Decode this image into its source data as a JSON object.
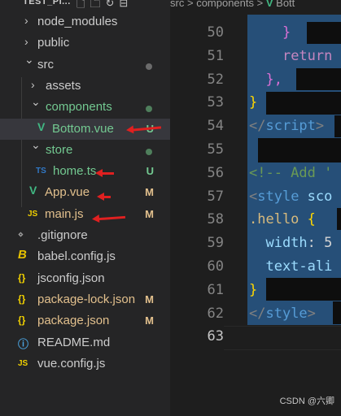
{
  "explorer": {
    "title": "TEST_PI...",
    "header_icons": [
      "new-file-icon",
      "new-folder-icon",
      "refresh-icon",
      "collapse-icon"
    ],
    "items": [
      {
        "label": "node_modules",
        "kind": "folder",
        "expanded": false,
        "color": "#cccccc"
      },
      {
        "label": "public",
        "kind": "folder",
        "expanded": false,
        "color": "#cccccc"
      },
      {
        "label": "src",
        "kind": "folder",
        "expanded": true,
        "color": "#cccccc",
        "status": "dot",
        "status_color": "#6b6b6b"
      },
      {
        "label": "assets",
        "kind": "folder",
        "expanded": false,
        "color": "#cccccc"
      },
      {
        "label": "components",
        "kind": "folder",
        "expanded": true,
        "color": "#73c991",
        "status": "dot",
        "status_color": "#4f7f5c"
      },
      {
        "label": "Bottom.vue",
        "kind": "file",
        "icon": "vue",
        "color": "#73c991",
        "status": "U",
        "selected": true
      },
      {
        "label": "store",
        "kind": "folder",
        "expanded": true,
        "color": "#73c991",
        "status": "dot",
        "status_color": "#4f7f5c"
      },
      {
        "label": "home.ts",
        "kind": "file",
        "icon": "TS",
        "color": "#73c991",
        "status": "U"
      },
      {
        "label": "App.vue",
        "kind": "file",
        "icon": "vue",
        "color": "#e2c08d",
        "status": "M"
      },
      {
        "label": "main.js",
        "kind": "file",
        "icon": "JS",
        "color": "#e2c08d",
        "status": "M"
      },
      {
        "label": ".gitignore",
        "kind": "file",
        "icon": "git",
        "color": "#cccccc"
      },
      {
        "label": "babel.config.js",
        "kind": "file",
        "icon": "babel",
        "color": "#cccccc"
      },
      {
        "label": "jsconfig.json",
        "kind": "file",
        "icon": "{}",
        "color": "#cccccc"
      },
      {
        "label": "package-lock.json",
        "kind": "file",
        "icon": "{}",
        "color": "#e2c08d",
        "status": "M"
      },
      {
        "label": "package.json",
        "kind": "file",
        "icon": "{}",
        "color": "#e2c08d",
        "status": "M"
      },
      {
        "label": "README.md",
        "kind": "file",
        "icon": "info",
        "color": "#cccccc"
      },
      {
        "label": "vue.config.js",
        "kind": "file",
        "icon": "JS",
        "color": "#cccccc"
      }
    ]
  },
  "editor": {
    "breadcrumb": {
      "part1": "src",
      "sep": ">",
      "part2": "components",
      "part3": "Bott"
    },
    "line_numbers": [
      "50",
      "51",
      "52",
      "53",
      "54",
      "55",
      "56",
      "57",
      "58",
      "59",
      "60",
      "61",
      "62",
      "63"
    ],
    "active_line": "63",
    "lines": [
      {
        "parts": [
          {
            "t": "    ",
            "c": "#d4d4d4"
          },
          {
            "t": "}",
            "c": "#da70d6"
          }
        ]
      },
      {
        "parts": [
          {
            "t": "    ",
            "c": "#d4d4d4"
          },
          {
            "t": "return",
            "c": "#c586c0"
          }
        ]
      },
      {
        "parts": [
          {
            "t": "  ",
            "c": "#d4d4d4"
          },
          {
            "t": "},",
            "c": "#da70d6"
          }
        ]
      },
      {
        "parts": [
          {
            "t": "}",
            "c": "#ffd700"
          }
        ]
      },
      {
        "parts": [
          {
            "t": "</",
            "c": "#808080"
          },
          {
            "t": "script",
            "c": "#569cd6"
          },
          {
            "t": ">",
            "c": "#808080"
          }
        ]
      },
      {
        "parts": []
      },
      {
        "parts": [
          {
            "t": "<!-- Add '",
            "c": "#6a9955"
          }
        ]
      },
      {
        "parts": [
          {
            "t": "<",
            "c": "#808080"
          },
          {
            "t": "style",
            "c": "#569cd6"
          },
          {
            "t": " sco",
            "c": "#9cdcfe"
          }
        ]
      },
      {
        "parts": [
          {
            "t": ".hello",
            "c": "#d7ba7d"
          },
          {
            "t": " {",
            "c": "#ffd700"
          }
        ]
      },
      {
        "parts": [
          {
            "t": "  width",
            "c": "#9cdcfe"
          },
          {
            "t": ": 5",
            "c": "#d4d4d4"
          }
        ]
      },
      {
        "parts": [
          {
            "t": "  text-ali",
            "c": "#9cdcfe"
          }
        ]
      },
      {
        "parts": [
          {
            "t": "}",
            "c": "#ffd700"
          }
        ]
      },
      {
        "parts": [
          {
            "t": "</",
            "c": "#808080"
          },
          {
            "t": "style",
            "c": "#569cd6"
          },
          {
            "t": ">",
            "c": "#808080"
          }
        ]
      },
      {
        "parts": []
      }
    ]
  },
  "watermark": "CSDN @六卿"
}
